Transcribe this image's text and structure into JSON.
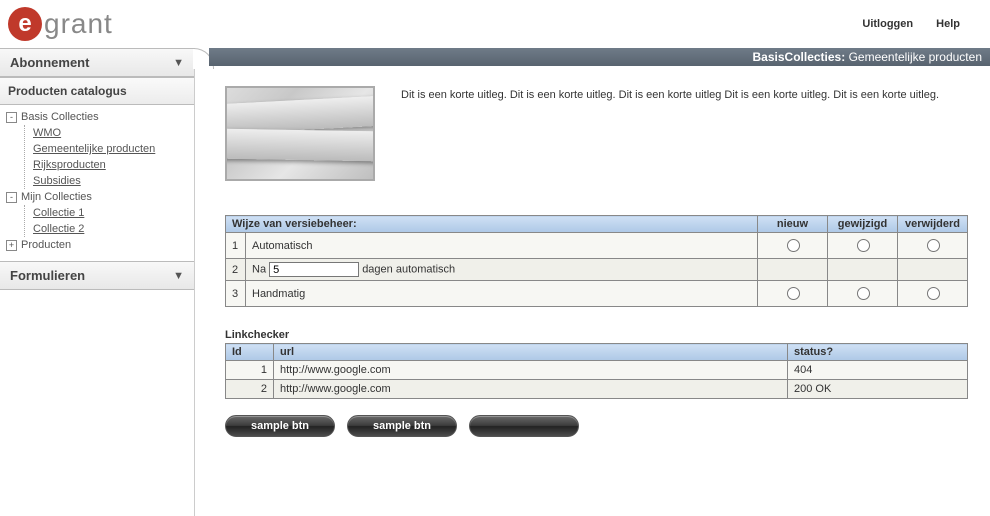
{
  "top": {
    "logo_letter": "e",
    "logo_text": "grant",
    "nav": {
      "logout": "Uitloggen",
      "help": "Help"
    }
  },
  "sidebar": {
    "accordion_abonnement": "Abonnement",
    "accordion_formulieren": "Formulieren",
    "catalog_title": "Producten catalogus",
    "nodes": [
      {
        "label": "Basis Collecties",
        "expander": "-",
        "children": [
          "WMO",
          "Gemeentelijke producten",
          "Rijksproducten",
          "Subsidies"
        ]
      },
      {
        "label": "Mijn Collecties",
        "expander": "-",
        "children": [
          "Collectie 1",
          "Collectie 2"
        ]
      },
      {
        "label": "Producten",
        "expander": "+",
        "children": []
      }
    ]
  },
  "titlebar": {
    "section": "BasisCollecties:",
    "page": "Gemeentelijke producten"
  },
  "intro_text": "Dit is een korte uitleg. Dit is een korte uitleg. Dit is een korte uitleg Dit is een korte uitleg. Dit is een korte uitleg.",
  "version_table": {
    "header_main": "Wijze van versiebeheer:",
    "cols": [
      "nieuw",
      "gewijzigd",
      "verwijderd"
    ],
    "rows": [
      {
        "n": "1",
        "label_a": "Automatisch",
        "label_b": "",
        "has_input": false
      },
      {
        "n": "2",
        "label_a": "Na",
        "input_value": "5",
        "label_b": "dagen automatisch",
        "has_input": true,
        "no_radios": true
      },
      {
        "n": "3",
        "label_a": "Handmatig",
        "label_b": "",
        "has_input": false
      }
    ]
  },
  "linkchecker": {
    "title": "Linkchecker",
    "headers": {
      "id": "Id",
      "url": "url",
      "status": "status?"
    },
    "rows": [
      {
        "id": "1",
        "url": "http://www.google.com",
        "status": "404"
      },
      {
        "id": "2",
        "url": "http://www.google.com",
        "status": "200 OK"
      }
    ]
  },
  "buttons": {
    "b1": "sample btn",
    "b2": "sample btn",
    "b3": ""
  }
}
